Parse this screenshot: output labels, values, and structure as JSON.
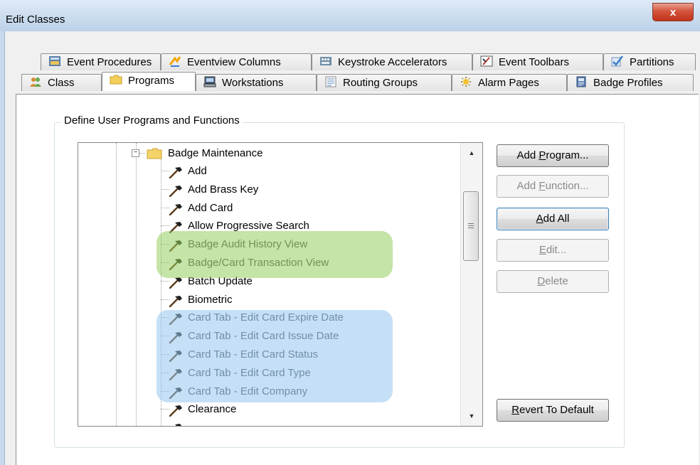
{
  "window": {
    "title": "Edit Classes",
    "close_glyph": "x"
  },
  "tabs_row1": [
    {
      "label": "Event Procedures",
      "icon": "event-procedures-icon"
    },
    {
      "label": "Eventview Columns",
      "icon": "eventview-columns-icon"
    },
    {
      "label": "Keystroke Accelerators",
      "icon": "keystroke-accelerators-icon"
    },
    {
      "label": "Event Toolbars",
      "icon": "event-toolbars-icon"
    },
    {
      "label": "Partitions",
      "icon": "partitions-icon"
    }
  ],
  "tabs_row2": [
    {
      "label": "Class",
      "icon": "class-users-icon"
    },
    {
      "label": "Programs",
      "icon": "folder-icon",
      "selected": true
    },
    {
      "label": "Workstations",
      "icon": "workstations-icon"
    },
    {
      "label": "Routing Groups",
      "icon": "routing-groups-icon"
    },
    {
      "label": "Alarm Pages",
      "icon": "alarm-pages-icon"
    },
    {
      "label": "Badge Profiles",
      "icon": "badge-profiles-icon"
    }
  ],
  "group": {
    "legend": "Define User Programs and Functions"
  },
  "tree": {
    "folder": {
      "label": "Badge Maintenance",
      "expander": "−"
    },
    "items": [
      {
        "label": "Add"
      },
      {
        "label": "Add Brass Key"
      },
      {
        "label": "Add Card"
      },
      {
        "label": "Allow Progressive Search"
      },
      {
        "label": "Badge Audit History View"
      },
      {
        "label": "Badge/Card Transaction View"
      },
      {
        "label": "Batch Update"
      },
      {
        "label": "Biometric"
      },
      {
        "label": "Card Tab - Edit Card Expire Date"
      },
      {
        "label": "Card Tab - Edit Card Issue Date"
      },
      {
        "label": "Card Tab - Edit Card Status"
      },
      {
        "label": "Card Tab - Edit Card Type"
      },
      {
        "label": "Card Tab - Edit Company"
      },
      {
        "label": "Clearance"
      }
    ],
    "highlight_green": "#a8d977",
    "highlight_blue": "#a9d0f0"
  },
  "scrollbar": {
    "up": "▲",
    "down": "▼"
  },
  "buttons": {
    "add_program": {
      "pre": "Add ",
      "key": "P",
      "post": "rogram...",
      "enabled": true
    },
    "add_function": {
      "pre": "Add ",
      "key": "F",
      "post": "unction...",
      "enabled": false
    },
    "add_all": {
      "pre": "",
      "key": "A",
      "post": "dd All",
      "enabled": true
    },
    "edit": {
      "pre": "",
      "key": "E",
      "post": "dit...",
      "enabled": false
    },
    "delete": {
      "pre": "",
      "key": "D",
      "post": "elete",
      "enabled": false
    },
    "revert": {
      "pre": "",
      "key": "R",
      "post": "evert To Default",
      "enabled": true
    }
  }
}
